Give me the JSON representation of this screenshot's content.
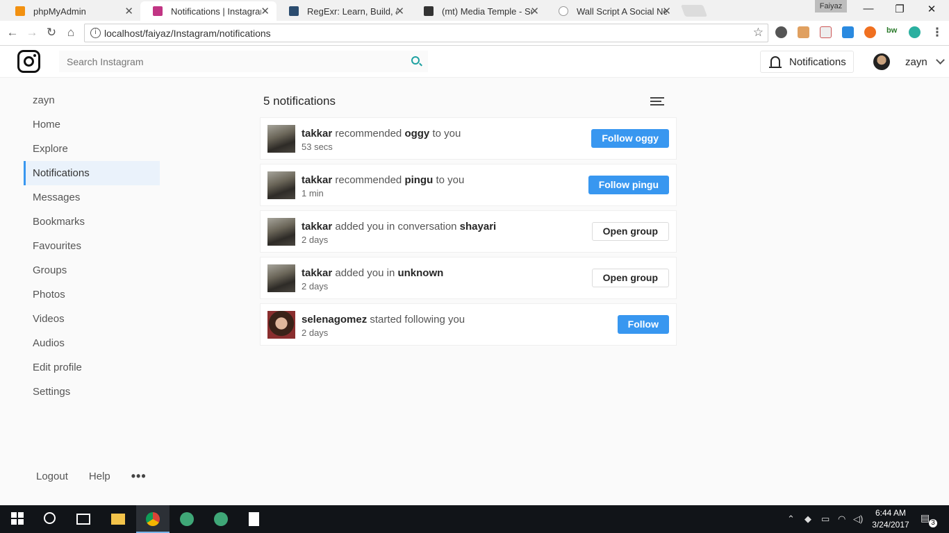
{
  "browser": {
    "tabs": [
      {
        "title": "phpMyAdmin",
        "icon": "phpmyadmin-icon",
        "color": "#f29111"
      },
      {
        "title": "Notifications | Instagram",
        "icon": "instagram-icon",
        "color": "#c13584"
      },
      {
        "title": "RegExr: Learn, Build, & Te",
        "icon": "regexr-icon",
        "color": "#2b4c6f"
      },
      {
        "title": "(mt) Media Temple - Sup",
        "icon": "mediatemple-icon",
        "color": "#333333"
      },
      {
        "title": "Wall Script A Social Netw",
        "icon": "page-icon",
        "color": "#999999"
      }
    ],
    "profile_name": "Faiyaz",
    "url": "localhost/faiyaz/Instagram/notifications"
  },
  "header": {
    "search_placeholder": "Search Instagram",
    "notifications_label": "Notifications",
    "username": "zayn"
  },
  "sidebar": {
    "items": [
      {
        "label": "zayn"
      },
      {
        "label": "Home"
      },
      {
        "label": "Explore"
      },
      {
        "label": "Notifications",
        "active": true
      },
      {
        "label": "Messages"
      },
      {
        "label": "Bookmarks"
      },
      {
        "label": "Favourites"
      },
      {
        "label": "Groups"
      },
      {
        "label": "Photos"
      },
      {
        "label": "Videos"
      },
      {
        "label": "Audios"
      },
      {
        "label": "Edit profile"
      },
      {
        "label": "Settings"
      }
    ],
    "footer": {
      "logout": "Logout",
      "help": "Help",
      "more": "•••"
    }
  },
  "main": {
    "count_title": "5 notifications",
    "notifications": [
      {
        "actor": "takkar",
        "action": "recommended",
        "object": "oggy",
        "suffix": "to you",
        "time": "53 secs",
        "button": "Follow oggy",
        "button_style": "primary"
      },
      {
        "actor": "takkar",
        "action": "recommended",
        "object": "pingu",
        "suffix": "to you",
        "time": "1 min",
        "button": "Follow pingu",
        "button_style": "primary"
      },
      {
        "actor": "takkar",
        "action": "added you in conversation",
        "object": "shayari",
        "suffix": "",
        "time": "2 days",
        "button": "Open group",
        "button_style": "secondary"
      },
      {
        "actor": "takkar",
        "action": "added you in",
        "object": "unknown",
        "suffix": "",
        "time": "2 days",
        "button": "Open group",
        "button_style": "secondary"
      },
      {
        "actor": "selenagomez",
        "action": "started following you",
        "object": "",
        "suffix": "",
        "time": "2 days",
        "button": "Follow",
        "button_style": "primary"
      }
    ]
  },
  "taskbar": {
    "time": "6:44 AM",
    "date": "3/24/2017",
    "notification_count": "3"
  },
  "colors": {
    "accent": "#3897f0",
    "active_bg": "#eaf2fb"
  }
}
